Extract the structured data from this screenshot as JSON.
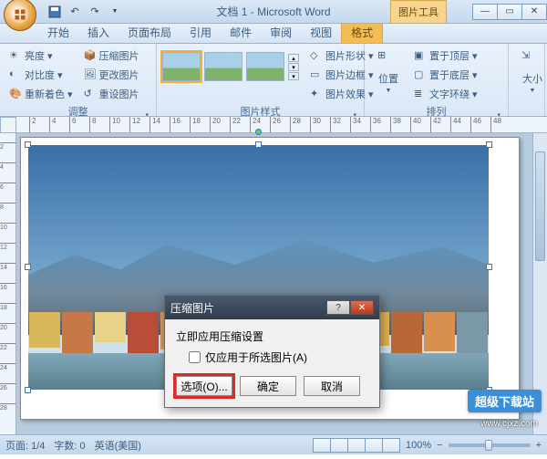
{
  "title": "文档 1 - Microsoft Word",
  "context_tab": "图片工具",
  "tabs": [
    "开始",
    "插入",
    "页面布局",
    "引用",
    "邮件",
    "审阅",
    "视图",
    "格式"
  ],
  "active_tab": "格式",
  "ribbon": {
    "adjust": {
      "label": "调整",
      "brightness": "亮度",
      "contrast": "对比度",
      "recolor": "重新着色",
      "compress": "压缩图片",
      "change": "更改图片",
      "reset": "重设图片"
    },
    "styles": {
      "label": "图片样式",
      "shape": "图片形状",
      "border": "图片边框",
      "effects": "图片效果"
    },
    "arrange": {
      "label": "排列",
      "position": "位置",
      "bring_front": "置于顶层",
      "send_back": "置于底层",
      "wrap": "文字环绕"
    },
    "size": {
      "label": "大小"
    }
  },
  "dialog": {
    "title": "压缩图片",
    "heading": "立即应用压缩设置",
    "checkbox": "仅应用于所选图片(A)",
    "options": "选项(O)...",
    "ok": "确定",
    "cancel": "取消"
  },
  "status": {
    "page": "页面: 1/4",
    "words": "字数: 0",
    "lang": "英语(美国)",
    "zoom": "100%"
  },
  "watermark": "超级下载站",
  "watermark_url": "www.cjxz.com",
  "ruler_marks": [
    2,
    4,
    6,
    8,
    10,
    12,
    14,
    16,
    18,
    20,
    22,
    24,
    26,
    28,
    30,
    32,
    34,
    36,
    38,
    40,
    42,
    44,
    46,
    48
  ],
  "vruler_marks": [
    2,
    4,
    6,
    8,
    10,
    12,
    14,
    16,
    18,
    20,
    22,
    24,
    26,
    28
  ]
}
